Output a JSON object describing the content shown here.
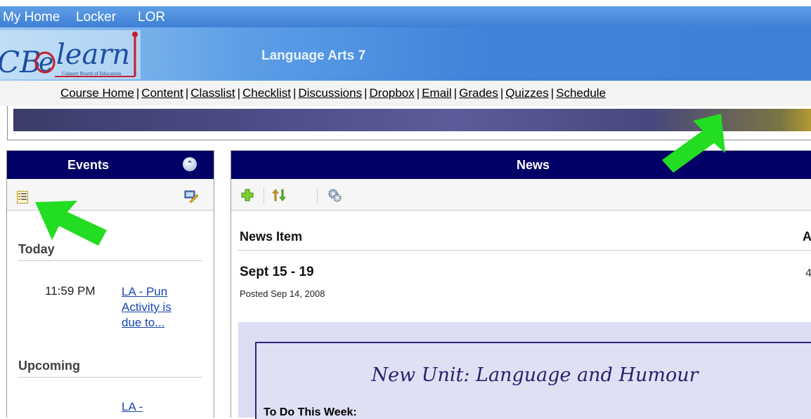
{
  "topbar": {
    "links": [
      "My Home",
      "Locker",
      "LOR"
    ]
  },
  "banner": {
    "logo_text": "CBe-learn",
    "logo_subtitle": "Calgary Board of Education",
    "course_title": "Language Arts 7"
  },
  "nav": {
    "items": [
      "Course Home",
      "Content",
      "Classlist",
      "Checklist",
      "Discussions",
      "Dropbox",
      "Email",
      "Grades",
      "Quizzes",
      "Schedule"
    ],
    "separator": "|"
  },
  "events": {
    "title": "Events",
    "today_label": "Today",
    "today_event": {
      "time": "11:59 PM",
      "link_lines": [
        "LA - Pun",
        "Activity is",
        "due to..."
      ]
    },
    "upcoming_label": "Upcoming",
    "upcoming_event": {
      "link_lines": [
        "LA -"
      ]
    }
  },
  "news": {
    "title": "News",
    "column_header": "News Item",
    "column_header_2": "A",
    "item": {
      "title": "Sept 15 - 19",
      "right_text": "4",
      "posted": "Posted Sep 14, 2008",
      "unit_title": "New Unit: Language and Humour",
      "todo": "To Do This Week:"
    }
  },
  "icons": {
    "collapse": "chevron-up-circle-icon",
    "event_list": "list-icon",
    "event_edit": "edit-icon",
    "add": "add-icon",
    "sort": "sort-icon",
    "settings": "gear-icon"
  },
  "colors": {
    "panel_header": "#000066",
    "link": "#1a46b0",
    "arrow": "#22dd22"
  }
}
